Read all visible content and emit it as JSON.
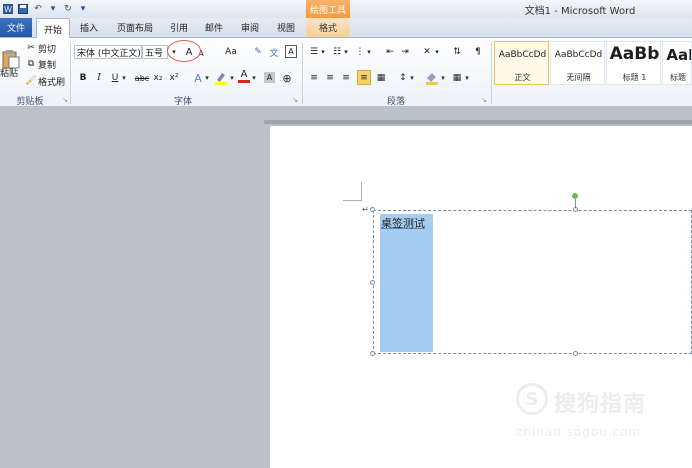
{
  "window": {
    "title": "文档1 - Microsoft Word"
  },
  "quick_access": {
    "icons": [
      "word-logo-icon",
      "save-icon",
      "undo-icon",
      "redo-icon",
      "customize-icon"
    ]
  },
  "contextual": {
    "group_label": "绘图工具"
  },
  "tabs": [
    {
      "label": "文件",
      "kind": "file"
    },
    {
      "label": "开始",
      "kind": "active"
    },
    {
      "label": "插入"
    },
    {
      "label": "页面布局"
    },
    {
      "label": "引用"
    },
    {
      "label": "邮件"
    },
    {
      "label": "审阅"
    },
    {
      "label": "视图"
    },
    {
      "label": "格式",
      "kind": "contextual"
    }
  ],
  "clipboard": {
    "paste_label": "粘贴",
    "cut_label": "剪切",
    "copy_label": "复制",
    "format_painter_label": "格式刷",
    "group_label": "剪贴板"
  },
  "font": {
    "font_name": "宋体 (中文正文)",
    "font_size": "五号",
    "grow_glyph": "A",
    "shrink_glyph": "A",
    "case_glyph": "Aa",
    "bold": "B",
    "italic": "I",
    "underline": "U",
    "strike": "abc",
    "subscript": "x₂",
    "superscript": "x²",
    "text_effect_glyph": "A",
    "font_color_glyph": "A",
    "char_shading_glyph": "A",
    "group_label": "字体"
  },
  "paragraph": {
    "group_label": "段落"
  },
  "styles": {
    "items": [
      {
        "preview": "AaBbCcDd",
        "name": "正文",
        "selected": true
      },
      {
        "preview": "AaBbCcDd",
        "name": "无间隔"
      },
      {
        "preview": "AaBb",
        "name": "标题 1"
      },
      {
        "preview": "AaB",
        "name": "标题"
      }
    ]
  },
  "document": {
    "textbox_text": "桌签测试",
    "paragraph_mark": "↵"
  },
  "watermark": {
    "logo_glyph": "S",
    "name": "搜狗指南",
    "url": "zhinan.sogou.com"
  },
  "colors": {
    "file_tab": "#1f58a8",
    "contextual_tab": "#f39a3c",
    "selection": "#a6cdf0",
    "highlight": "#ffff00",
    "font_color": "#e02020",
    "rotation_handle": "#6cc04a",
    "annotation_circle": "#e05a4a"
  }
}
